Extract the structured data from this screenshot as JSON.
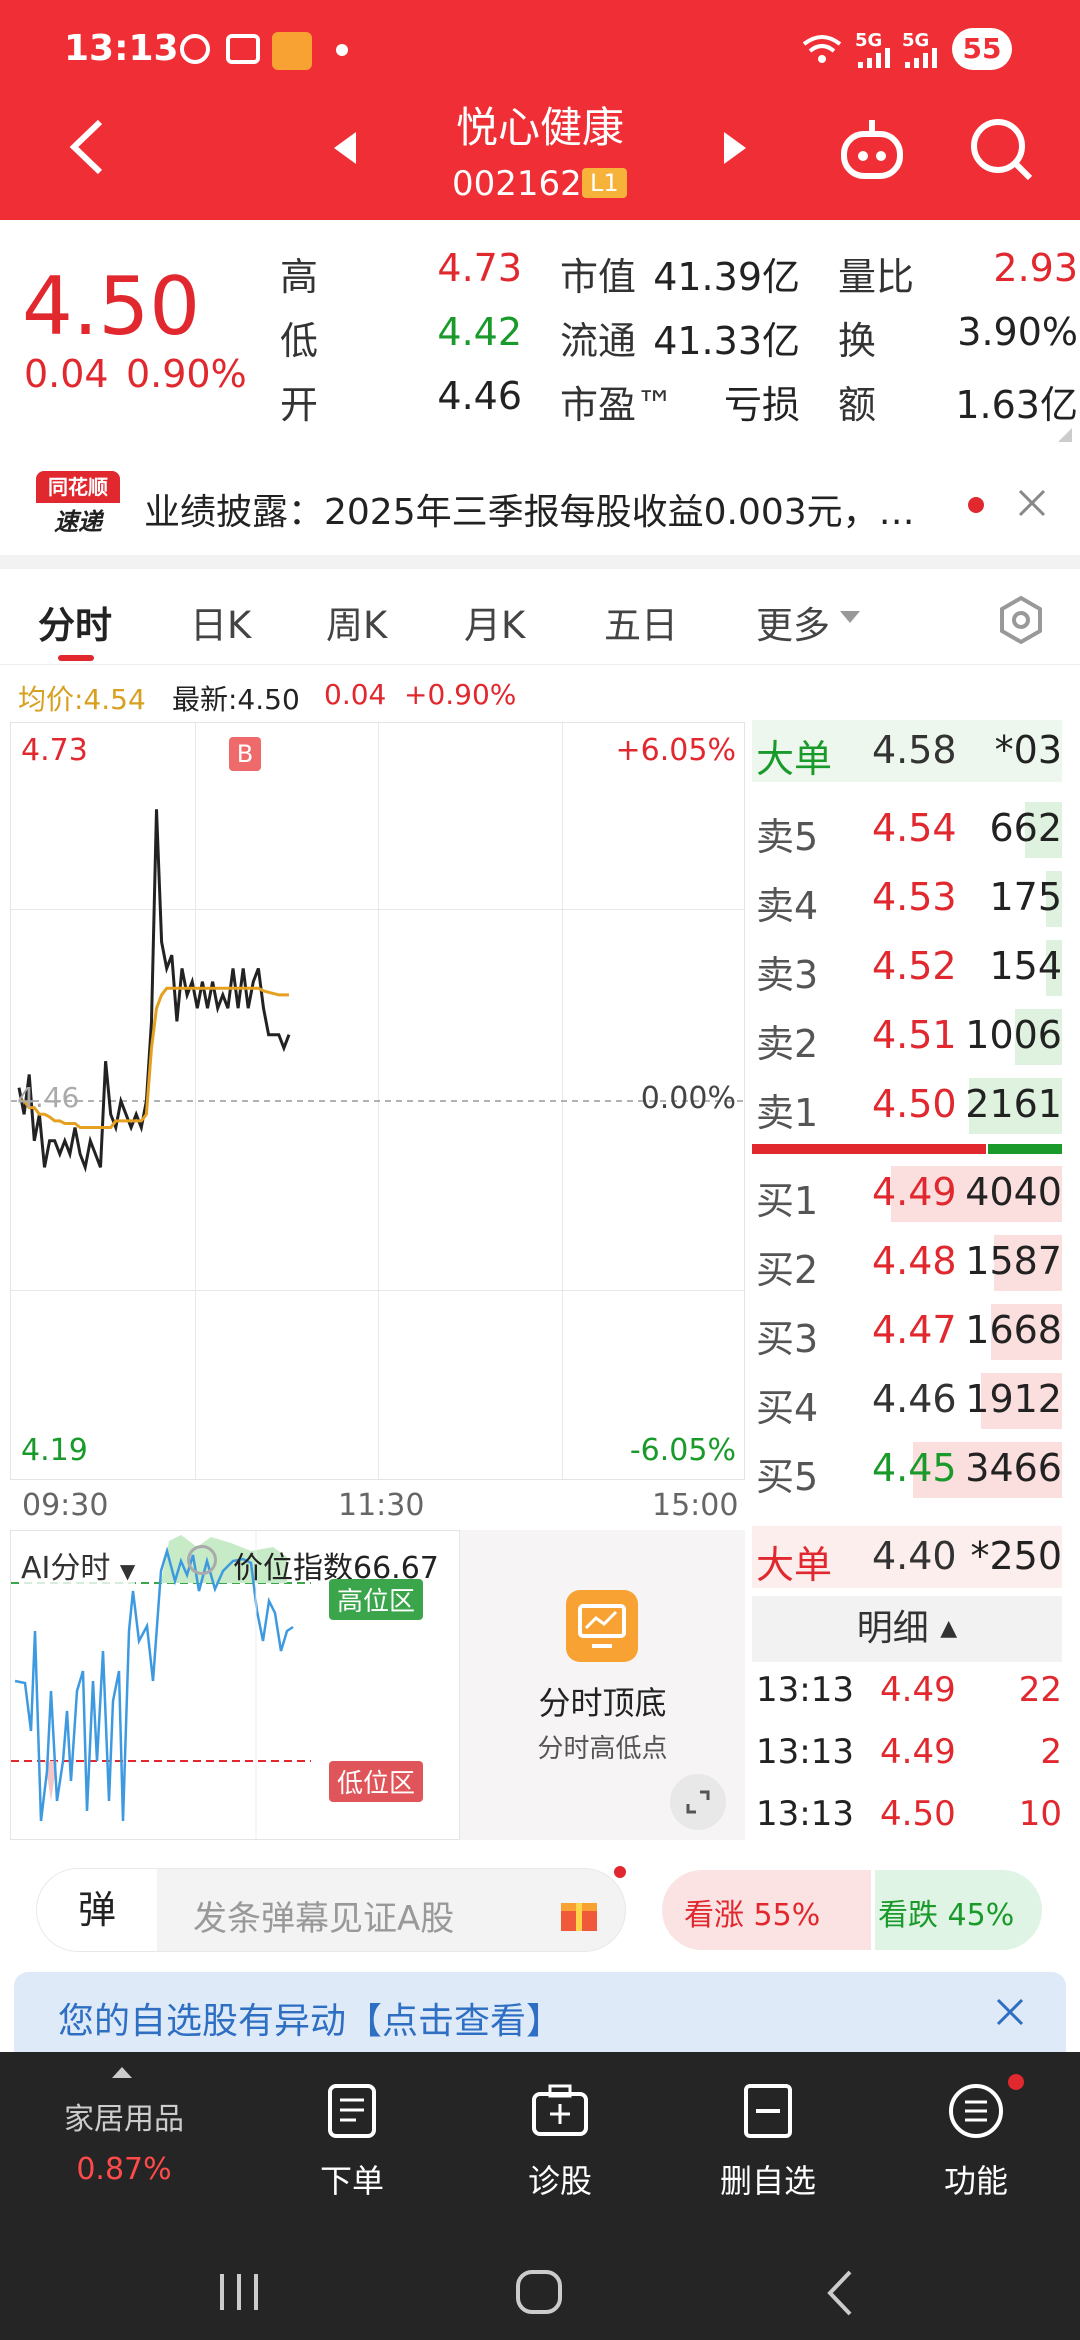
{
  "status_bar": {
    "time": "13:13",
    "signal1": "5G",
    "signal2": "5G",
    "battery": "55"
  },
  "header": {
    "title": "悦心健康",
    "code": "002162",
    "level_badge": "L1"
  },
  "quote": {
    "price": "4.50",
    "change": "0.04",
    "change_pct": "0.90%"
  },
  "stats": {
    "high_label": "高",
    "high": "4.73",
    "low_label": "低",
    "low": "4.42",
    "open_label": "开",
    "open": "4.46",
    "mktcap_label": "市值",
    "mktcap": "41.39亿",
    "float_label": "流通",
    "float": "41.33亿",
    "pe_label": "市盈™",
    "pe": "亏损",
    "volratio_label": "量比",
    "volratio": "2.93",
    "turnover_label": "换",
    "turnover": "3.90%",
    "amount_label": "额",
    "amount": "1.63亿"
  },
  "news": {
    "logo_top": "同花顺",
    "logo_bottom": "速递",
    "text": "业绩披露：2025年三季报每股收益0.003元，…"
  },
  "tabs": {
    "t1": "分时",
    "t2": "日K",
    "t3": "周K",
    "t4": "月K",
    "t5": "五日",
    "t6": "更多"
  },
  "chart_info": {
    "avg_label": "均价:4.54",
    "latest_label": "最新:4.50",
    "chg": "0.04",
    "chg_pct": "+0.90%"
  },
  "chart": {
    "y_top": "4.73",
    "y_bottom": "4.19",
    "y_mid": "4.46",
    "pct_top": "+6.05%",
    "pct_mid": "0.00%",
    "pct_bottom": "-6.05%",
    "x_start": "09:30",
    "x_mid": "11:30",
    "x_end": "15:00",
    "marker": "B"
  },
  "chart_data": {
    "type": "line",
    "ylim": [
      4.19,
      4.73
    ],
    "series": [
      {
        "values": [
          4.47,
          4.45,
          4.48,
          4.43,
          4.45,
          4.41,
          4.43,
          4.43,
          4.42,
          4.43,
          4.42,
          4.44,
          4.42,
          4.41,
          4.43,
          4.42,
          4.41,
          4.49,
          4.45,
          4.44,
          4.46,
          4.45,
          4.44,
          4.45,
          4.44,
          4.46,
          4.52,
          4.68,
          4.58,
          4.56,
          4.57,
          4.52,
          4.56,
          4.54,
          4.55,
          4.53,
          4.55,
          4.53,
          4.55,
          4.53,
          4.54,
          4.53,
          4.56,
          4.53,
          4.56,
          4.53,
          4.55,
          4.56,
          4.53,
          4.51,
          4.51,
          4.51,
          4.5,
          4.51
        ]
      },
      {
        "values": [
          4.46,
          4.46,
          4.455,
          4.455,
          4.45,
          4.45,
          4.448,
          4.445,
          4.445,
          4.443,
          4.443,
          4.443,
          4.44,
          4.44,
          4.44,
          4.44,
          4.44,
          4.44,
          4.44,
          4.445,
          4.445,
          4.445,
          4.445,
          4.445,
          4.445,
          4.45,
          4.5,
          4.53,
          4.54,
          4.545,
          4.545,
          4.545,
          4.545,
          4.545,
          4.545,
          4.545,
          4.545,
          4.545,
          4.545,
          4.545,
          4.545,
          4.545,
          4.545,
          4.545,
          4.545,
          4.545,
          4.545,
          4.545,
          4.543,
          4.542,
          4.541,
          4.54,
          4.54,
          4.54
        ]
      }
    ]
  },
  "orderbook": {
    "big_top": {
      "label": "大单",
      "price": "4.58",
      "vol": "*03"
    },
    "sells": [
      {
        "label": "卖5",
        "price": "4.54",
        "vol": "662",
        "fill": 0.12
      },
      {
        "label": "卖4",
        "price": "4.53",
        "vol": "175",
        "fill": 0.05
      },
      {
        "label": "卖3",
        "price": "4.52",
        "vol": "154",
        "fill": 0.05
      },
      {
        "label": "卖2",
        "price": "4.51",
        "vol": "1006",
        "fill": 0.15
      },
      {
        "label": "卖1",
        "price": "4.50",
        "vol": "2161",
        "fill": 0.3
      }
    ],
    "buys": [
      {
        "label": "买1",
        "price": "4.49",
        "vol": "4040",
        "fill": 0.55
      },
      {
        "label": "买2",
        "price": "4.48",
        "vol": "1587",
        "fill": 0.22
      },
      {
        "label": "买3",
        "price": "4.47",
        "vol": "1668",
        "fill": 0.23
      },
      {
        "label": "买4",
        "price": "4.46",
        "vol": "1912",
        "fill": 0.26
      },
      {
        "label": "买5",
        "price": "4.45",
        "vol": "3466",
        "fill": 0.48
      }
    ],
    "big_bottom": {
      "label": "大单",
      "price": "4.40",
      "vol": "*250"
    },
    "detail_label": "明细",
    "ticks": [
      {
        "time": "13:13",
        "price": "4.49",
        "vol": "22"
      },
      {
        "time": "13:13",
        "price": "4.49",
        "vol": "2"
      },
      {
        "time": "13:13",
        "price": "4.50",
        "vol": "10"
      }
    ]
  },
  "ai_panel": {
    "mode": "AI分时",
    "index_label": "价位指数66.67",
    "high_zone": "高位区",
    "low_zone": "低位区"
  },
  "feature": {
    "title": "分时顶底",
    "subtitle": "分时高低点"
  },
  "danmu": {
    "label": "弹",
    "placeholder": "发条弹幕见证A股",
    "bull": "看涨 55%",
    "bear": "看跌 45%",
    "bull_pct": 55
  },
  "banner": {
    "text": "您的自选股有异动【点击查看】"
  },
  "bottom_nav": {
    "sector": "家居用品",
    "sector_pct": "0.87%",
    "order": "下单",
    "diagnose": "诊股",
    "remove": "删自选",
    "more": "功能"
  }
}
